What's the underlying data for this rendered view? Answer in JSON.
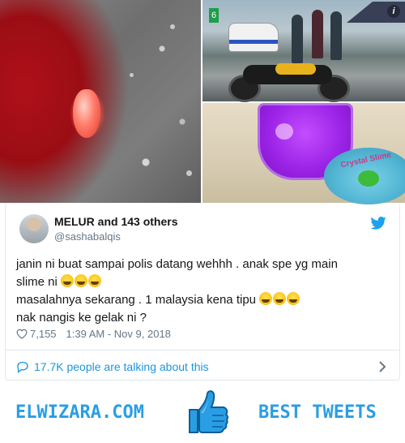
{
  "media": {
    "photos": [
      "left-photo",
      "top-right-photo",
      "bottom-right-photo"
    ],
    "sign_text": "6",
    "info_badge": "i",
    "lid_text": "Crystal Slime"
  },
  "tweet": {
    "author_name": "MELUR and 143 others",
    "handle": "@sashabalqis",
    "lines": [
      "janin ni buat sampai polis datang wehhh . anak spe yg main",
      "slime ni",
      "masalahnya sekarang . 1 malaysia kena tipu",
      "nak nangis ke gelak ni ?"
    ],
    "likes": "7,155",
    "timestamp": "1:39 AM - Nov 9, 2018",
    "talking": "17.7K people are talking about this"
  },
  "banner": {
    "site": "ELWIZARA.COM",
    "tagline": "BEST TWEETS"
  },
  "colors": {
    "accent": "#1b95e0",
    "banner_blue": "#2a9ee4",
    "text": "#14171a",
    "muted": "#657786"
  }
}
